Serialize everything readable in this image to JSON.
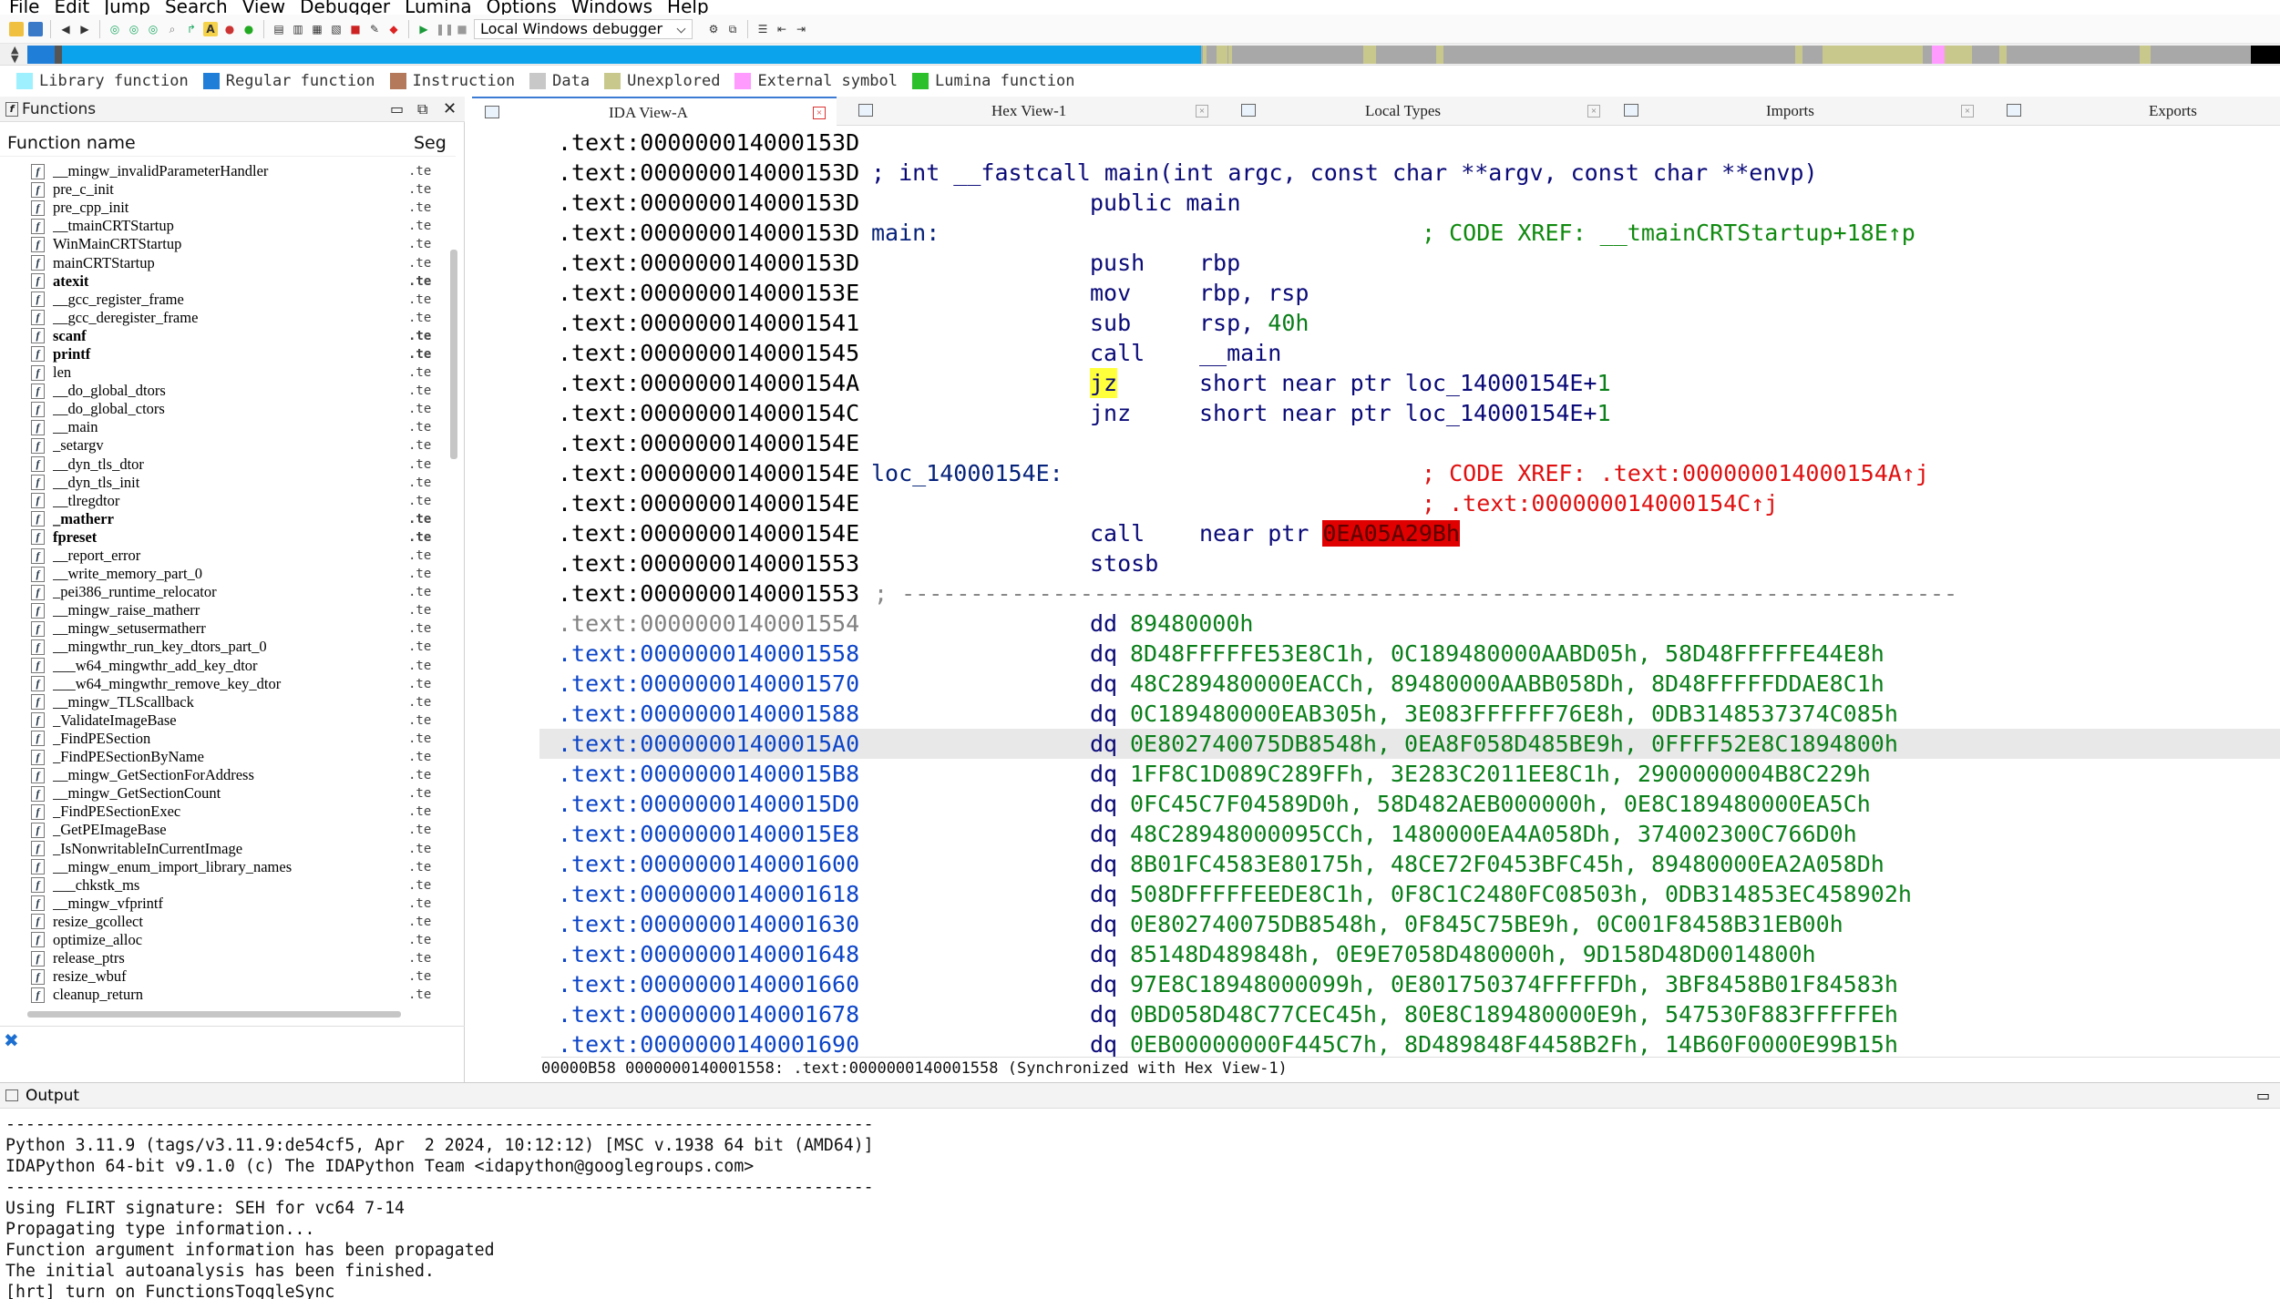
{
  "menu": [
    "File",
    "Edit",
    "Jump",
    "Search",
    "View",
    "Debugger",
    "Lumina",
    "Options",
    "Windows",
    "Help"
  ],
  "toolbar": {
    "debugger_select": "Local Windows debugger"
  },
  "legend": [
    {
      "label": "Library function",
      "color": "#9ef0ff"
    },
    {
      "label": "Regular function",
      "color": "#1f7fd8"
    },
    {
      "label": "Instruction",
      "color": "#b4785a"
    },
    {
      "label": "Data",
      "color": "#c8c8c8"
    },
    {
      "label": "Unexplored",
      "color": "#c8c88c"
    },
    {
      "label": "External symbol",
      "color": "#ff9aff"
    },
    {
      "label": "Lumina function",
      "color": "#2cc02c"
    }
  ],
  "functions": {
    "title": "Functions",
    "col_name": "Function name",
    "col_seg": "Seg",
    "items": [
      {
        "name": "__mingw_invalidParameterHandler",
        "seg": ".te",
        "bold": false
      },
      {
        "name": "pre_c_init",
        "seg": ".te",
        "bold": false
      },
      {
        "name": "pre_cpp_init",
        "seg": ".te",
        "bold": false
      },
      {
        "name": "__tmainCRTStartup",
        "seg": ".te",
        "bold": false
      },
      {
        "name": "WinMainCRTStartup",
        "seg": ".te",
        "bold": false
      },
      {
        "name": "mainCRTStartup",
        "seg": ".te",
        "bold": false
      },
      {
        "name": "atexit",
        "seg": ".te",
        "bold": true
      },
      {
        "name": "__gcc_register_frame",
        "seg": ".te",
        "bold": false
      },
      {
        "name": "__gcc_deregister_frame",
        "seg": ".te",
        "bold": false
      },
      {
        "name": "scanf",
        "seg": ".te",
        "bold": true
      },
      {
        "name": "printf",
        "seg": ".te",
        "bold": true
      },
      {
        "name": "len",
        "seg": ".te",
        "bold": false
      },
      {
        "name": "__do_global_dtors",
        "seg": ".te",
        "bold": false
      },
      {
        "name": "__do_global_ctors",
        "seg": ".te",
        "bold": false
      },
      {
        "name": "__main",
        "seg": ".te",
        "bold": false
      },
      {
        "name": "_setargv",
        "seg": ".te",
        "bold": false
      },
      {
        "name": "__dyn_tls_dtor",
        "seg": ".te",
        "bold": false
      },
      {
        "name": "__dyn_tls_init",
        "seg": ".te",
        "bold": false
      },
      {
        "name": "__tlregdtor",
        "seg": ".te",
        "bold": false
      },
      {
        "name": "_matherr",
        "seg": ".te",
        "bold": true
      },
      {
        "name": "fpreset",
        "seg": ".te",
        "bold": true
      },
      {
        "name": "__report_error",
        "seg": ".te",
        "bold": false
      },
      {
        "name": "__write_memory_part_0",
        "seg": ".te",
        "bold": false
      },
      {
        "name": "_pei386_runtime_relocator",
        "seg": ".te",
        "bold": false
      },
      {
        "name": "__mingw_raise_matherr",
        "seg": ".te",
        "bold": false
      },
      {
        "name": "__mingw_setusermatherr",
        "seg": ".te",
        "bold": false
      },
      {
        "name": "__mingwthr_run_key_dtors_part_0",
        "seg": ".te",
        "bold": false
      },
      {
        "name": "___w64_mingwthr_add_key_dtor",
        "seg": ".te",
        "bold": false
      },
      {
        "name": "___w64_mingwthr_remove_key_dtor",
        "seg": ".te",
        "bold": false
      },
      {
        "name": "__mingw_TLScallback",
        "seg": ".te",
        "bold": false
      },
      {
        "name": "_ValidateImageBase",
        "seg": ".te",
        "bold": false
      },
      {
        "name": "_FindPESection",
        "seg": ".te",
        "bold": false
      },
      {
        "name": "_FindPESectionByName",
        "seg": ".te",
        "bold": false
      },
      {
        "name": "__mingw_GetSectionForAddress",
        "seg": ".te",
        "bold": false
      },
      {
        "name": "__mingw_GetSectionCount",
        "seg": ".te",
        "bold": false
      },
      {
        "name": "_FindPESectionExec",
        "seg": ".te",
        "bold": false
      },
      {
        "name": "_GetPEImageBase",
        "seg": ".te",
        "bold": false
      },
      {
        "name": "_IsNonwritableInCurrentImage",
        "seg": ".te",
        "bold": false
      },
      {
        "name": "__mingw_enum_import_library_names",
        "seg": ".te",
        "bold": false
      },
      {
        "name": "___chkstk_ms",
        "seg": ".te",
        "bold": false
      },
      {
        "name": "__mingw_vfprintf",
        "seg": ".te",
        "bold": false
      },
      {
        "name": "resize_gcollect",
        "seg": ".te",
        "bold": false
      },
      {
        "name": "optimize_alloc",
        "seg": ".te",
        "bold": false
      },
      {
        "name": "release_ptrs",
        "seg": ".te",
        "bold": false
      },
      {
        "name": "resize_wbuf",
        "seg": ".te",
        "bold": false
      },
      {
        "name": "cleanup_return",
        "seg": ".te",
        "bold": false
      }
    ]
  },
  "tabs": [
    {
      "label": "IDA View-A",
      "active": true
    },
    {
      "label": "Hex View-1",
      "active": false
    },
    {
      "label": "Local Types",
      "active": false
    },
    {
      "label": "Imports",
      "active": false
    },
    {
      "label": "Exports",
      "active": false
    }
  ],
  "disasm": {
    "lines": [
      {
        "addr": ".text:000000014000153D",
        "style": "black"
      },
      {
        "addr": ".text:000000014000153D",
        "style": "black",
        "proto": "; int __fastcall main(int argc, const char **argv, const char **envp)"
      },
      {
        "addr": ".text:000000014000153D",
        "style": "black",
        "mn": "public main"
      },
      {
        "addr": ".text:000000014000153D",
        "style": "black",
        "label": "main:",
        "comment": "; CODE XREF: __tmainCRTStartup+18E↑p"
      },
      {
        "addr": ".text:000000014000153D",
        "style": "black",
        "mn": "push",
        "op": "rbp"
      },
      {
        "addr": ".text:000000014000153E",
        "style": "black",
        "mn": "mov",
        "op": "rbp, rsp"
      },
      {
        "addr": ".text:0000000140001541",
        "style": "black",
        "mn": "sub",
        "op": "rsp, ",
        "opnum": "40h"
      },
      {
        "addr": ".text:0000000140001545",
        "style": "black",
        "mn": "call",
        "op": "__main"
      },
      {
        "addr": ".text:000000014000154A",
        "style": "black",
        "mn": "jz",
        "mnhl": true,
        "op": "short near ptr loc_14000154E+",
        "opnum": "1"
      },
      {
        "addr": ".text:000000014000154C",
        "style": "black",
        "mn": "jnz",
        "op": "short near ptr loc_14000154E+",
        "opnum": "1"
      },
      {
        "addr": ".text:000000014000154E",
        "style": "black"
      },
      {
        "addr": ".text:000000014000154E",
        "style": "black",
        "label": "loc_14000154E:",
        "rcomment": "; CODE XREF: .text:000000014000154A↑j"
      },
      {
        "addr": ".text:000000014000154E",
        "style": "black",
        "rcomment2": "; .text:000000014000154C↑j"
      },
      {
        "addr": ".text:000000014000154E",
        "style": "black",
        "mn": "call",
        "op": "near ptr ",
        "oprb": "0EA05A29Bh"
      },
      {
        "addr": ".text:0000000140001553",
        "style": "black",
        "mn": "stosb"
      },
      {
        "addr": ".text:0000000140001553",
        "style": "black",
        "sep": " ; -----------------------------------------------------------------------------"
      },
      {
        "addr": ".text:0000000140001554",
        "style": "gray",
        "dmn": "dd",
        "dop": "89480000h"
      },
      {
        "addr": ".text:0000000140001558",
        "style": "blue",
        "dmn": "dq",
        "dop": "8D48FFFFFE53E8C1h, 0C189480000AABD05h, 58D48FFFFFE44E8h"
      },
      {
        "addr": ".text:0000000140001570",
        "style": "blue",
        "dmn": "dq",
        "dop": "48C289480000EACCh, 89480000AABB058Dh, 8D48FFFFFDDAE8C1h"
      },
      {
        "addr": ".text:0000000140001588",
        "style": "blue",
        "dmn": "dq",
        "dop": "0C189480000EAB305h, 3E083FFFFFF76E8h, 0DB3148537374C085h"
      },
      {
        "addr": ".text:00000001400015A0",
        "style": "blue",
        "hl": true,
        "dmn": "dq",
        "dop": "0E802740075DB8548h, 0EA8F058D485BE9h, 0FFFF52E8C1894800h"
      },
      {
        "addr": ".text:00000001400015B8",
        "style": "blue",
        "dmn": "dq",
        "dop": "1FF8C1D089C289FFh, 3E283C2011EE8C1h, 2900000004B8C229h"
      },
      {
        "addr": ".text:00000001400015D0",
        "style": "blue",
        "dmn": "dq",
        "dop": "0FC45C7F04589D0h, 58D482AEB000000h, 0E8C189480000EA5Ch"
      },
      {
        "addr": ".text:00000001400015E8",
        "style": "blue",
        "dmn": "dq",
        "dop": "48C28948000095CCh, 1480000EA4A058Dh, 374002300C766D0h"
      },
      {
        "addr": ".text:0000000140001600",
        "style": "blue",
        "dmn": "dq",
        "dop": "8B01FC4583E80175h, 48CE72F0453BFC45h, 89480000EA2A058Dh"
      },
      {
        "addr": ".text:0000000140001618",
        "style": "blue",
        "dmn": "dq",
        "dop": "508DFFFFFEEDE8C1h, 0F8C1C2480FC08503h, 0DB314853EC458902h"
      },
      {
        "addr": ".text:0000000140001630",
        "style": "blue",
        "dmn": "dq",
        "dop": "0E802740075DB8548h, 0F845C75BE9h, 0C001F8458B31EB00h"
      },
      {
        "addr": ".text:0000000140001648",
        "style": "blue",
        "dmn": "dq",
        "dop": "85148D489848h, 0E9E7058D480000h, 9D158D48D0014800h"
      },
      {
        "addr": ".text:0000000140001660",
        "style": "blue",
        "dmn": "dq",
        "dop": "97E8C18948000099h, 0E801750374FFFFFDh, 3BF8458B01F84583h"
      },
      {
        "addr": ".text:0000000140001678",
        "style": "blue",
        "dmn": "dq",
        "dop": "0BD058D48C77CEC45h, 80E8C189480000E9h, 547530F883FFFFFEh"
      },
      {
        "addr": ".text:0000000140001690",
        "style": "blue",
        "dmn": "dq",
        "dop": "0EB00000000F445C7h, 8D489848F4458B2Fh, 14B60F0000E99B15h"
      }
    ],
    "status": "00000B58 0000000140001558: .text:0000000140001558 (Synchronized with Hex View-1)"
  },
  "output": {
    "title": "Output",
    "lines": [
      "---------------------------------------------------------------------------------------",
      "Python 3.11.9 (tags/v3.11.9:de54cf5, Apr  2 2024, 10:12:12) [MSC v.1938 64 bit (AMD64)]",
      "IDAPython 64-bit v9.1.0 (c) The IDAPython Team <idapython@googlegroups.com>",
      "---------------------------------------------------------------------------------------",
      "Using FLIRT signature: SEH for vc64 7-14",
      "Propagating type information...",
      "Function argument information has been propagated",
      "The initial autoanalysis has been finished.",
      "[hrt] turn on FunctionsToggleSync"
    ]
  }
}
